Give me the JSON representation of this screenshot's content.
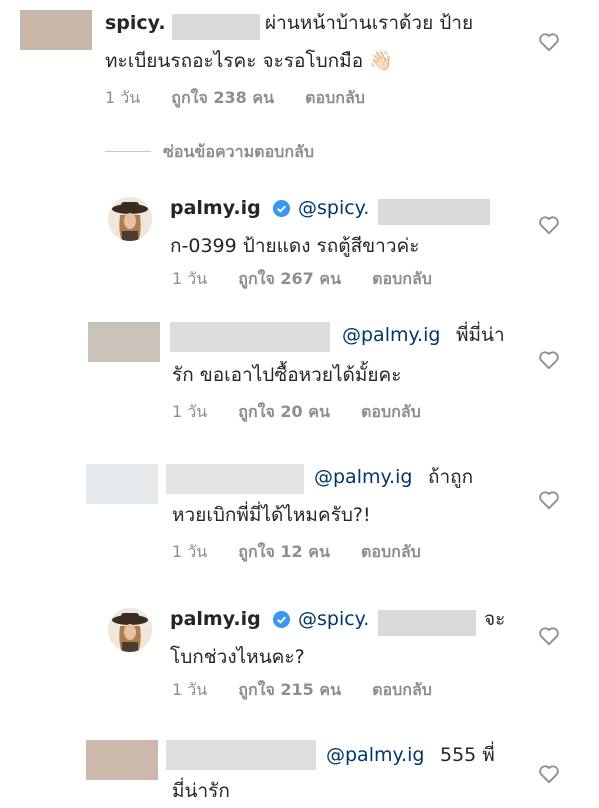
{
  "comments": [
    {
      "line1_prefix": "spicy.",
      "line1_rest": "ผ่านหน้าบ้านเราด้วย ป้าย",
      "line2": "ทะเบียนรถอะไรคะ จะรอโบกมือ 👋🏻",
      "time": "1 วัน",
      "likes": "ถูกใจ 238 คน",
      "reply": "ตอบกลับ"
    },
    {
      "username": "palmy.ig",
      "mention": "@spicy.",
      "line2": "ก-0399 ป้ายแดง รถตู้สีขาวค่ะ",
      "time": "1 วัน",
      "likes": "ถูกใจ 267 คน",
      "reply": "ตอบกลับ"
    },
    {
      "mention": "@palmy.ig",
      "line1_rest": "พี่มี่น่า",
      "line2": "รัก ขอเอาไปซื้อหวยได้มั้ยคะ",
      "time": "1 วัน",
      "likes": "ถูกใจ 20 คน",
      "reply": "ตอบกลับ"
    },
    {
      "mention": "@palmy.ig",
      "line1_rest": "ถ้าถูก",
      "line2": "หวยเบิกพี่มี่ได้ไหมครับ?!",
      "time": "1 วัน",
      "likes": "ถูกใจ 12 คน",
      "reply": "ตอบกลับ"
    },
    {
      "username": "palmy.ig",
      "mention": "@spicy.",
      "line1_rest": "จะ",
      "line2": "โบกช่วงไหนคะ?",
      "time": "1 วัน",
      "likes": "ถูกใจ 215 คน",
      "reply": "ตอบกลับ"
    },
    {
      "mention": "@palmy.ig",
      "line1_rest": "555 พี่",
      "line2": "มี่น่ารัก"
    }
  ],
  "hide_replies": "ซ่อนข้อความตอบกลับ",
  "icons": {
    "like": "heart-outline-icon",
    "verified": "verified-badge-icon"
  },
  "colors": {
    "mention": "#00376b",
    "meta": "#8e8e8e",
    "verified": "#3897f0"
  }
}
